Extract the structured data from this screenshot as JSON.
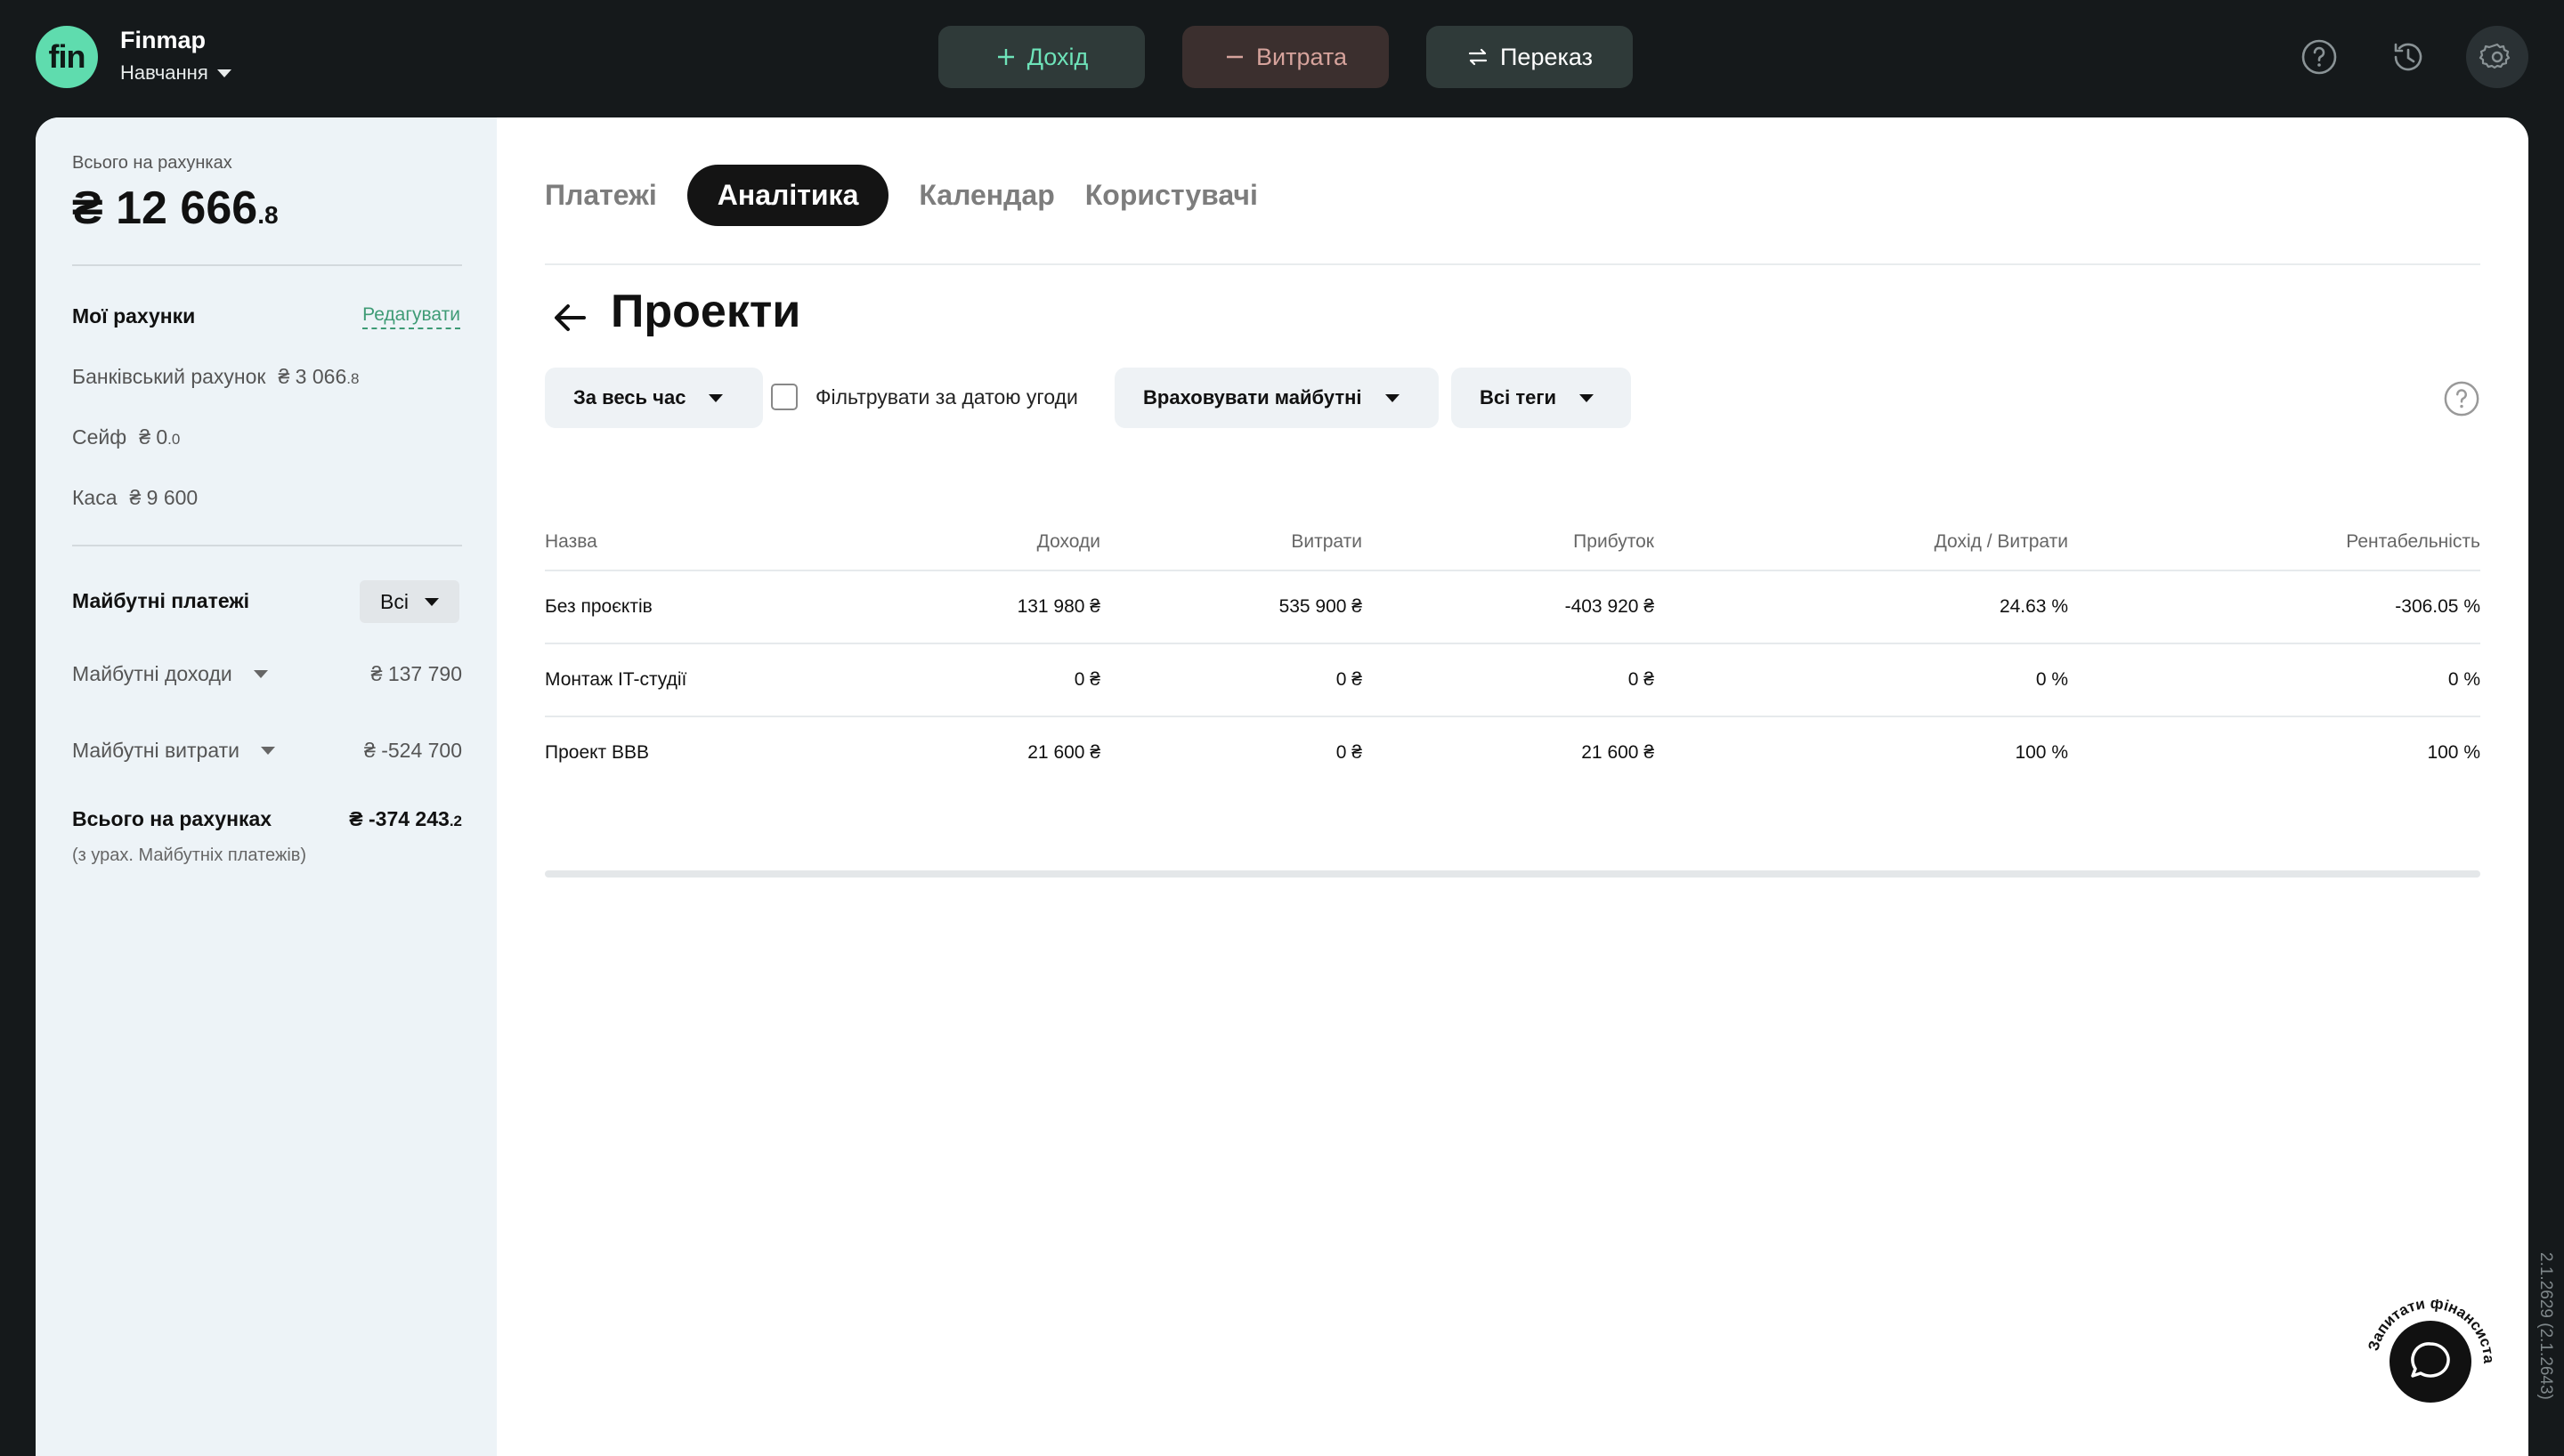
{
  "brand": {
    "logo": "fin",
    "name": "Finmap",
    "workspace": "Навчання"
  },
  "top_actions": {
    "income": "Дохід",
    "expense": "Витрата",
    "transfer": "Переказ"
  },
  "top_icons": [
    "help-circle-icon",
    "history-icon",
    "gear-icon"
  ],
  "sidebar": {
    "total_label": "Всього на рахунках",
    "total_value": "₴ 12 666",
    "total_decimal": ".8",
    "accounts_title": "Мої рахунки",
    "edit_label": "Редагувати",
    "accounts": [
      {
        "name": "Банківський рахунок",
        "value": "₴ 3 066",
        "decimal": ".8"
      },
      {
        "name": "Сейф",
        "value": "₴ 0",
        "decimal": ".0"
      },
      {
        "name": "Каса",
        "value": "₴ 9 600",
        "decimal": ""
      }
    ],
    "future_title": "Майбутні платежі",
    "future_filter": "Всі",
    "future_income_label": "Майбутні доходи",
    "future_income_value": "₴ 137 790",
    "future_expense_label": "Майбутні витрати",
    "future_expense_value": "₴ -524 700",
    "grand_label": "Всього на рахунках",
    "grand_value": "₴ -374 243",
    "grand_decimal": ".2",
    "grand_note": "(з урах. Майбутніх платежів)"
  },
  "tabs": [
    {
      "label": "Платежі",
      "active": false
    },
    {
      "label": "Аналітика",
      "active": true
    },
    {
      "label": "Календар",
      "active": false
    },
    {
      "label": "Користувачі",
      "active": false
    }
  ],
  "page_title": "Проекти",
  "filters": {
    "period": "За весь час",
    "deal_date_checkbox": "Фільтрувати за датою угоди",
    "future": "Враховувати майбутні",
    "tags": "Всі теги"
  },
  "table": {
    "columns": [
      "Назва",
      "Доходи",
      "Витрати",
      "Прибуток",
      "Дохід / Витрати",
      "Рентабельність"
    ],
    "rows": [
      [
        "Без проєктів",
        "131 980 ₴",
        "535 900 ₴",
        "-403 920 ₴",
        "24.63 %",
        "-306.05 %"
      ],
      [
        "Монтаж IT-студії",
        "0 ₴",
        "0 ₴",
        "0 ₴",
        "0 %",
        "0 %"
      ],
      [
        "Проект BBB",
        "21 600 ₴",
        "0 ₴",
        "21 600 ₴",
        "100 %",
        "100 %"
      ]
    ]
  },
  "chat": {
    "label": "Запитати фінансиста",
    "icon": "chat-bubble-icon"
  },
  "version": "2.1.2629 (2.1.2643)"
}
